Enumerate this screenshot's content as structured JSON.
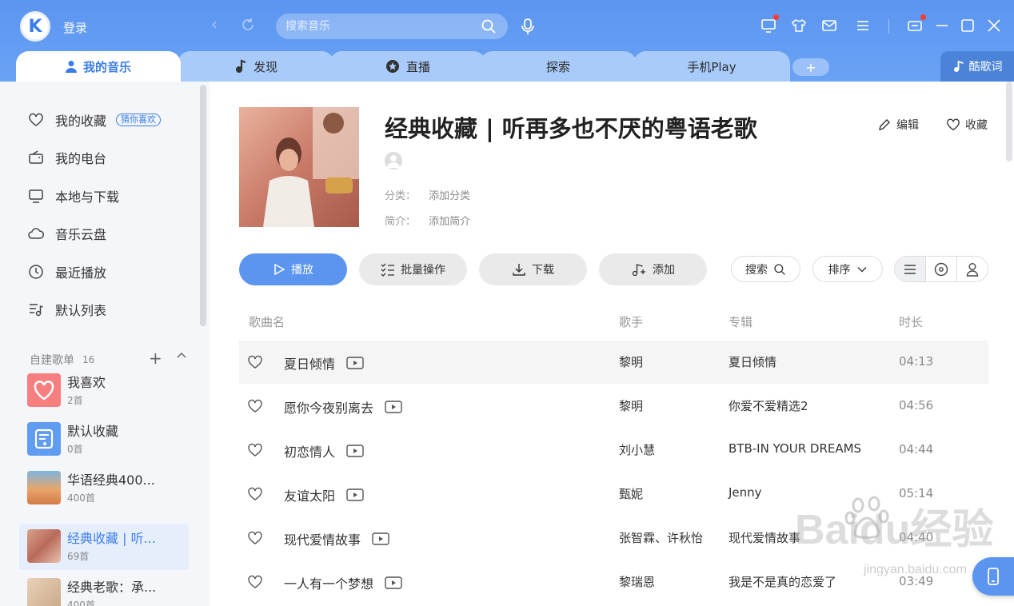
{
  "header": {
    "login_label": "登录",
    "search_placeholder": "搜索音乐",
    "logo_letter": "K"
  },
  "tabs": [
    {
      "label": "我的音乐"
    },
    {
      "label": "发现"
    },
    {
      "label": "直播"
    },
    {
      "label": "探索"
    },
    {
      "label": "手机Play"
    }
  ],
  "tab_add": "+",
  "lyric_button": "酷歌词",
  "sidebar": {
    "items": [
      {
        "label": "我的收藏",
        "badge": "猜你喜欢"
      },
      {
        "label": "我的电台"
      },
      {
        "label": "本地与下载"
      },
      {
        "label": "音乐云盘"
      },
      {
        "label": "最近播放"
      },
      {
        "label": "默认列表"
      }
    ],
    "playlists_header": "自建歌单",
    "playlists_count": "16",
    "playlists": [
      {
        "title": "我喜欢",
        "count": "2首"
      },
      {
        "title": "默认收藏",
        "count": "0首"
      },
      {
        "title": "华语经典400...",
        "count": "400首"
      },
      {
        "title": "经典收藏 | 听...",
        "count": "69首"
      },
      {
        "title": "经典老歌：承...",
        "count": "400首"
      }
    ]
  },
  "playlist": {
    "title": "经典收藏 | 听再多也不厌的粤语老歌",
    "category_label": "分类：",
    "category_value": "添加分类",
    "intro_label": "简介：",
    "intro_value": "添加简介",
    "edit_label": "编辑",
    "fav_label": "收藏"
  },
  "toolbar": {
    "play": "播放",
    "batch": "批量操作",
    "download": "下载",
    "add": "添加",
    "search": "搜索",
    "sort": "排序"
  },
  "columns": {
    "name": "歌曲名",
    "artist": "歌手",
    "album": "专辑",
    "duration": "时长"
  },
  "songs": [
    {
      "name": "夏日倾情",
      "artist": "黎明",
      "album": "夏日倾情",
      "duration": "04:13"
    },
    {
      "name": "愿你今夜别离去",
      "artist": "黎明",
      "album": "你爱不爱精选2",
      "duration": "04:56"
    },
    {
      "name": "初恋情人",
      "artist": "刘小慧",
      "album": "BTB-IN YOUR DREAMS",
      "duration": "04:44"
    },
    {
      "name": "友谊太阳",
      "artist": "甄妮",
      "album": "Jenny",
      "duration": "05:14"
    },
    {
      "name": "现代爱情故事",
      "artist": "张智霖、许秋怡",
      "album": "现代爱情故事",
      "duration": "04:40"
    },
    {
      "name": "一人有一个梦想",
      "artist": "黎瑞恩",
      "album": "我是不是真的恋爱了",
      "duration": "03:49"
    }
  ],
  "watermark": {
    "main": "Baidu经验",
    "sub": "jingyan.baidu.com"
  },
  "colors": {
    "accent": "#5b95f0",
    "header": "#6aa3f5",
    "sidebar_bg": "#f4f6f9"
  }
}
